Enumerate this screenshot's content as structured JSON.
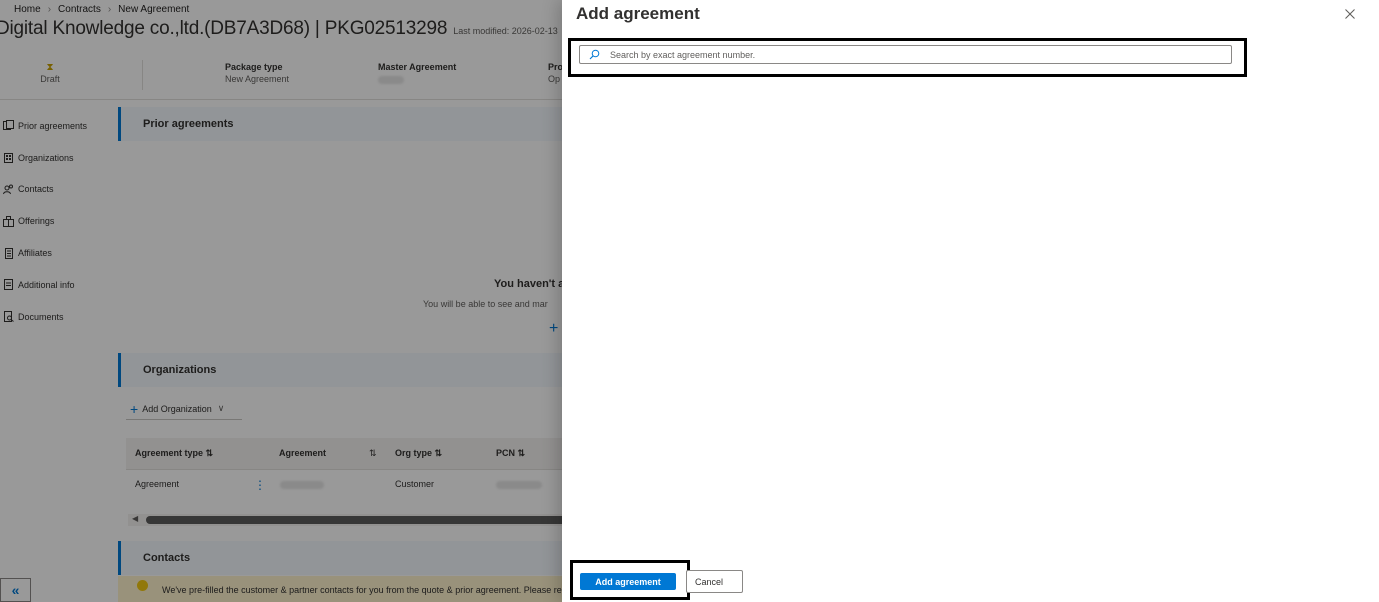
{
  "breadcrumb": [
    "Home",
    "Contracts",
    "New Agreement"
  ],
  "page": {
    "title": "Digital Knowledge co.,ltd.(DB7A3D68) | PKG02513298",
    "last_modified": "Last modified: 2026-02-13"
  },
  "summary": {
    "status": "Draft",
    "package_type_label": "Package type",
    "package_type_value": "New Agreement",
    "master_agreement_label": "Master Agreement",
    "truncated_label": "Pro",
    "truncated_value": "Op"
  },
  "nav": {
    "items": [
      {
        "label": "Prior agreements",
        "icon": "agreements-icon"
      },
      {
        "label": "Organizations",
        "icon": "building-icon"
      },
      {
        "label": "Contacts",
        "icon": "people-icon"
      },
      {
        "label": "Offerings",
        "icon": "offerings-icon"
      },
      {
        "label": "Affiliates",
        "icon": "document-icon"
      },
      {
        "label": "Additional info",
        "icon": "info-document-icon"
      },
      {
        "label": "Documents",
        "icon": "document-search-icon"
      }
    ],
    "collapse_glyph": "«"
  },
  "sections": {
    "prior_agreements": "Prior agreements",
    "organizations": "Organizations",
    "contacts": "Contacts"
  },
  "empty_state": {
    "title": "You haven't a",
    "subtitle": "You will be able to see and mar",
    "plus": "+"
  },
  "organizations": {
    "add_button": "Add Organization",
    "columns": [
      "Agreement type ⇅",
      "Agreement",
      "⇅",
      "Org type ⇅",
      "PCN ⇅"
    ],
    "rows": [
      {
        "agreement_type": "Agreement",
        "org_type": "Customer"
      }
    ]
  },
  "notice_text": "We've pre-filled the customer & partner contacts for you from the quote & prior agreement. Please re",
  "panel": {
    "title": "Add agreement",
    "search_placeholder": "Search by exact agreement number.",
    "primary_button": "Add agreement",
    "cancel_button": "Cancel"
  },
  "colors": {
    "accent": "#0078d4",
    "highlight_border": "#000000",
    "overlay": "rgba(0,0,0,0.40)"
  }
}
